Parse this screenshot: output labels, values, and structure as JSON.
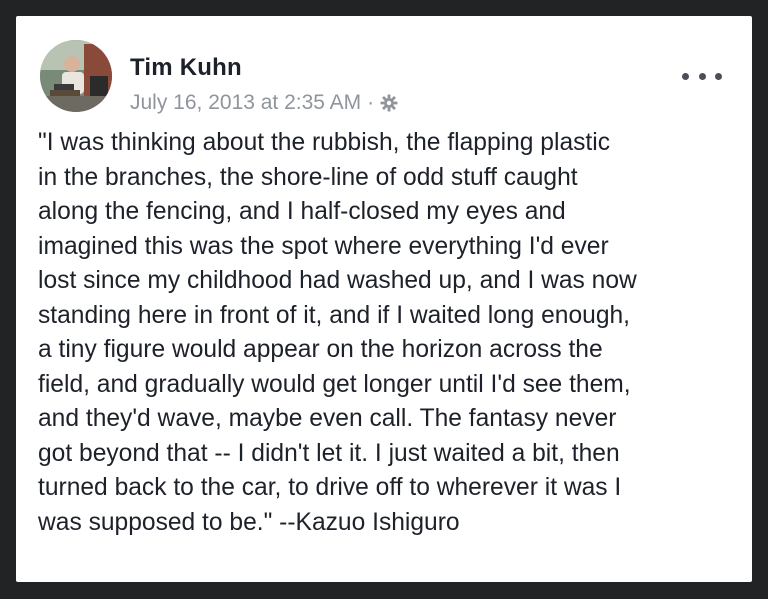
{
  "post": {
    "author": "Tim Kuhn",
    "timestamp": "July 16, 2013 at 2:35 AM",
    "separator": "·",
    "privacy_icon": "gear-icon",
    "more_icon": "more-options-icon",
    "text": "\"I was thinking about the rubbish, the flapping plastic\nin the branches, the shore-line of odd stuff caught\nalong the fencing, and I half-closed my eyes and\nimagined this was the spot where everything I'd ever\nlost since my childhood had washed up, and I was now\nstanding here in front of it, and if I waited long enough,\na tiny figure would appear on the horizon across the\nfield, and gradually would get longer until I'd see them,\nand they'd wave, maybe even call. The fantasy never\ngot beyond that -- I didn't let it. I just waited a bit, then\nturned back to the car, to drive off to wherever it was I\nwas supposed to be.\" --Kazuo Ishiguro"
  },
  "colors": {
    "background": "#222325",
    "card": "#ffffff",
    "author_text": "#1d2129",
    "meta_text": "#90949c"
  }
}
